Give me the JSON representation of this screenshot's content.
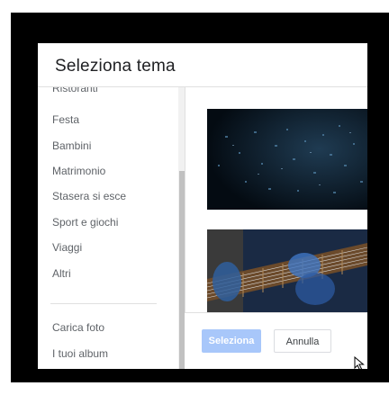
{
  "dialog": {
    "title": "Seleziona tema"
  },
  "sidebar": {
    "partial_item": "Ristoranti",
    "items": [
      {
        "label": "Festa"
      },
      {
        "label": "Bambini"
      },
      {
        "label": "Matrimonio"
      },
      {
        "label": "Stasera si esce"
      },
      {
        "label": "Sport e giochi"
      },
      {
        "label": "Viaggi"
      },
      {
        "label": "Altri"
      }
    ],
    "bottom_items": [
      {
        "label": "Carica foto"
      },
      {
        "label": "I tuoi album"
      }
    ]
  },
  "theme_images": [
    {
      "name": "city-lights-bokeh"
    },
    {
      "name": "guitar-player"
    }
  ],
  "footer": {
    "select_label": "Seleziona",
    "cancel_label": "Annulla"
  },
  "colors": {
    "select_button_disabled": "#a8c7fa",
    "backdrop": "#000000"
  }
}
